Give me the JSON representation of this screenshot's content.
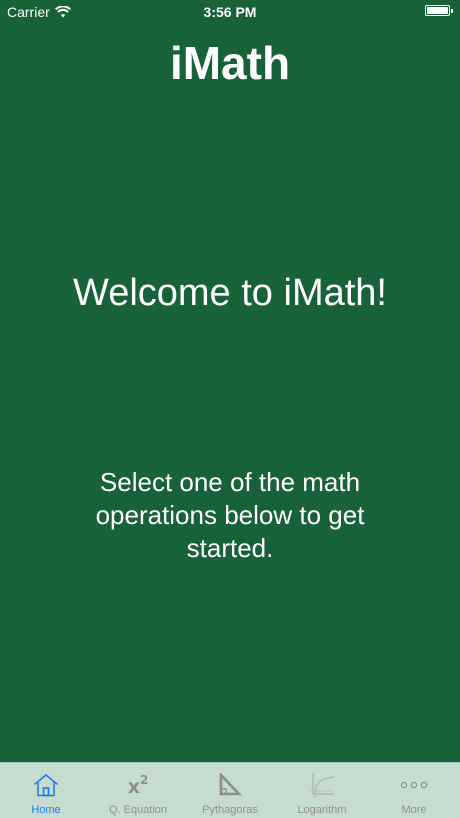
{
  "status_bar": {
    "carrier": "Carrier",
    "time": "3:56 PM"
  },
  "main": {
    "title": "iMath",
    "welcome": "Welcome to iMath!",
    "instructions": "Select one of the math operations below to get started."
  },
  "tabs": [
    {
      "label": "Home",
      "icon": "home-icon",
      "active": true
    },
    {
      "label": "Q. Equation",
      "icon": "x-squared-icon",
      "icon_text": "x",
      "icon_sup": "2",
      "active": false
    },
    {
      "label": "Pythagoras",
      "icon": "triangle-icon",
      "active": false
    },
    {
      "label": "Logarithm",
      "icon": "log-graph-icon",
      "active": false
    },
    {
      "label": "More",
      "icon": "more-icon",
      "active": false
    }
  ],
  "colors": {
    "background": "#176239",
    "tab_bar": "#c6dccf",
    "tab_active": "#1b7df2",
    "tab_inactive": "#929292",
    "text": "#ffffff"
  }
}
